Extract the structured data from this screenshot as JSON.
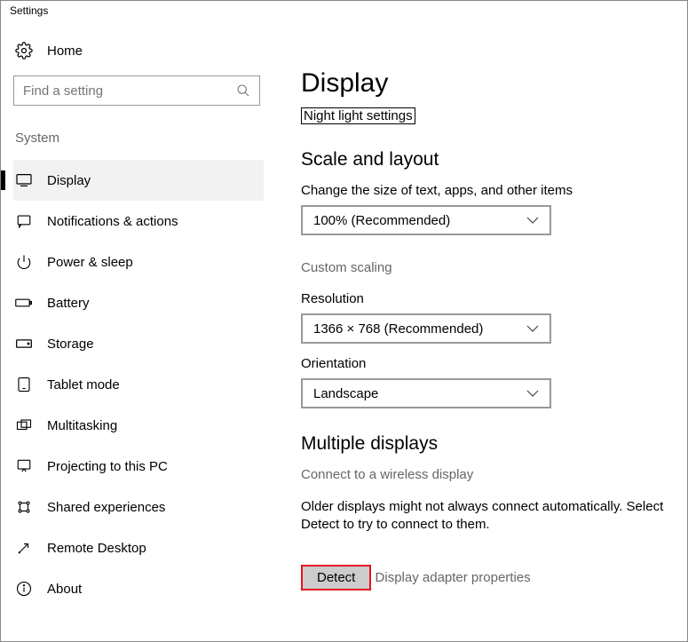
{
  "window": {
    "title": "Settings"
  },
  "sidebar": {
    "home": "Home",
    "search_placeholder": "Find a setting",
    "category": "System",
    "items": [
      {
        "label": "Display"
      },
      {
        "label": "Notifications & actions"
      },
      {
        "label": "Power & sleep"
      },
      {
        "label": "Battery"
      },
      {
        "label": "Storage"
      },
      {
        "label": "Tablet mode"
      },
      {
        "label": "Multitasking"
      },
      {
        "label": "Projecting to this PC"
      },
      {
        "label": "Shared experiences"
      },
      {
        "label": "Remote Desktop"
      },
      {
        "label": "About"
      }
    ]
  },
  "main": {
    "title": "Display",
    "night_light_link": "Night light settings",
    "scale_heading": "Scale and layout",
    "scale_label": "Change the size of text, apps, and other items",
    "scale_value": "100% (Recommended)",
    "custom_scaling": "Custom scaling",
    "resolution_label": "Resolution",
    "resolution_value": "1366 × 768 (Recommended)",
    "orientation_label": "Orientation",
    "orientation_value": "Landscape",
    "multi_heading": "Multiple displays",
    "wireless": "Connect to a wireless display",
    "older_desc": "Older displays might not always connect automatically. Select Detect to try to connect to them.",
    "detect": "Detect",
    "adapter": "Display adapter properties"
  }
}
